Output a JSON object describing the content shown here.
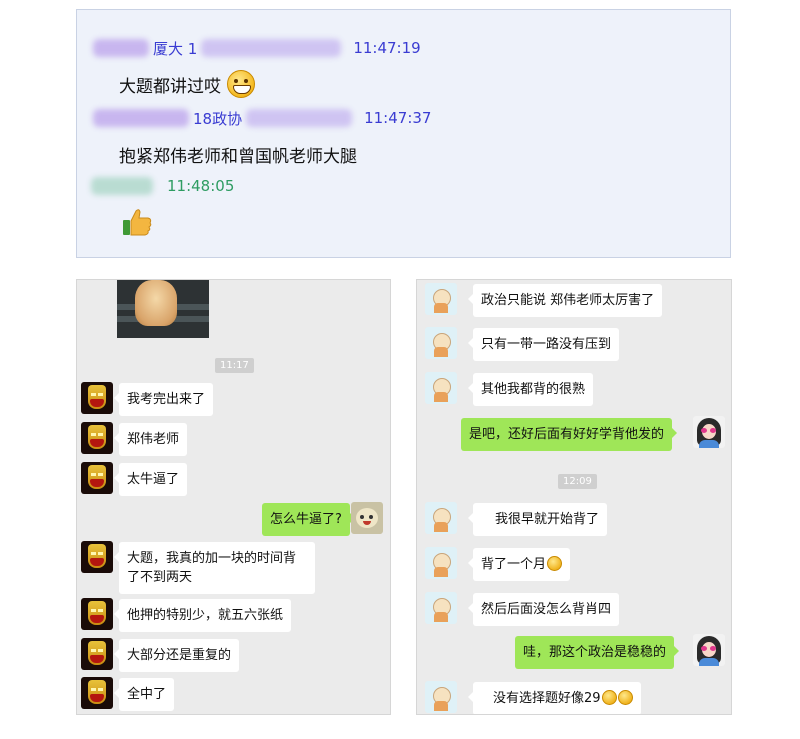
{
  "qq": {
    "messages": [
      {
        "name": "厦大 1",
        "time": "11:47:19",
        "text": "大题都讲过哎"
      },
      {
        "name": "18政协",
        "time": "11:47:37",
        "text": "抱紧郑伟老师和曾国帆老师大腿"
      },
      {
        "name": "",
        "time": "11:48:05",
        "text": ""
      }
    ]
  },
  "left_chat": {
    "timestamp": "11:17",
    "messages": [
      {
        "text": "我考完出来了"
      },
      {
        "text": "郑伟老师"
      },
      {
        "text": "太牛逼了"
      },
      {
        "text": "怎么牛逼了?"
      },
      {
        "text": "大题，我真的加一块的时间背了不到两天"
      },
      {
        "text": "他押的特别少，就五六张纸"
      },
      {
        "text": "大部分还是重复的"
      },
      {
        "text": "全中了"
      }
    ]
  },
  "right_chat": {
    "timestamp": "12:09",
    "messages": [
      {
        "text": "政治只能说 郑伟老师太厉害了"
      },
      {
        "text": "只有一带一路没有压到"
      },
      {
        "text": "其他我都背的很熟"
      },
      {
        "text": "是吧，还好后面有好好学背他发的"
      },
      {
        "text": "我很早就开始背了"
      },
      {
        "text": "背了一个月"
      },
      {
        "text": "然后后面没怎么背肖四"
      },
      {
        "text": "哇，那这个政治是稳稳的"
      },
      {
        "text": "没有选择题好像29"
      }
    ]
  },
  "icons": {
    "qq_emoji_1": "grinning-face-icon",
    "qq_emoji_2": "thumbs-up-icon",
    "inline_emoji": "sweat-smile-icon"
  },
  "colors": {
    "qq_name": "#3a3cd2",
    "qq_time_alt": "#2e9c62",
    "bubble_out": "#9fe658",
    "bubble_in": "#ffffff",
    "chat_bg": "#ebebeb"
  }
}
